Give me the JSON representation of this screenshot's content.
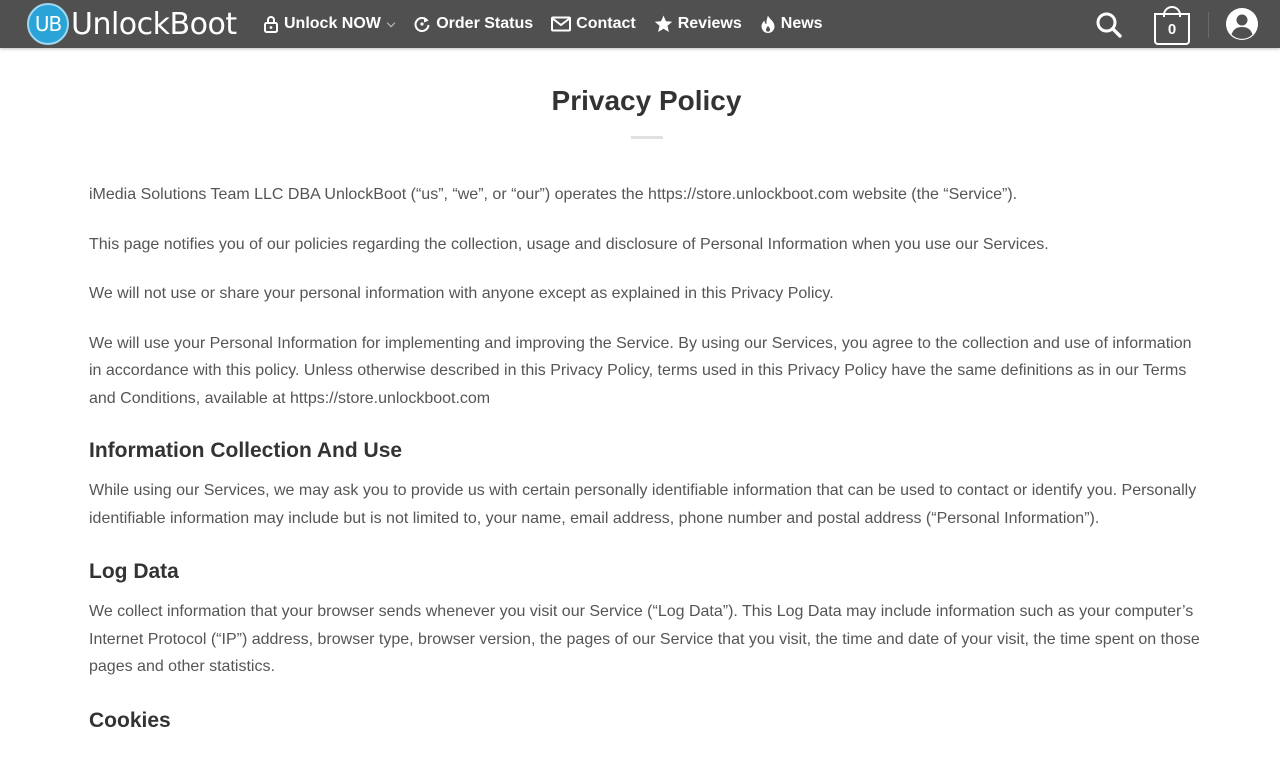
{
  "header": {
    "logo_badge": "UB",
    "logo_text": "UnlockBoot",
    "nav": [
      {
        "label": "Unlock NOW",
        "icon": "lock-icon",
        "has_dropdown": true
      },
      {
        "label": "Order Status",
        "icon": "refresh-icon"
      },
      {
        "label": "Contact",
        "icon": "envelope-icon"
      },
      {
        "label": "Reviews",
        "icon": "star-icon"
      },
      {
        "label": "News",
        "icon": "flame-icon"
      }
    ],
    "cart_count": "0",
    "colors": {
      "bar": "#505050",
      "logo_accent": "#2aa3d6"
    }
  },
  "page": {
    "title": "Privacy Policy",
    "paragraphs": [
      "iMedia Solutions Team LLC DBA UnlockBoot (“us”, “we”, or “our”) operates the https://store.unlockboot.com website (the “Service”).",
      "This page notifies you of our policies regarding the collection, usage and disclosure of Personal Information when you use our Services.",
      "We will not use or share your personal information with anyone except as explained in this Privacy Policy.",
      "We will use your Personal Information for implementing and improving the Service. By using our Services, you agree to the collection and use of information in accordance with this policy. Unless otherwise described in this Privacy Policy, terms used in this Privacy Policy have the same definitions as in our Terms and Conditions, available at https://store.unlockboot.com"
    ],
    "sections": [
      {
        "heading": "Information Collection And Use",
        "body": "While using our Services, we may ask you to provide us with certain personally identifiable information that can be used to contact or identify you. Personally identifiable information may include but is not limited to, your name, email address, phone number and postal address (“Personal Information”)."
      },
      {
        "heading": "Log Data",
        "body": "We collect information that your browser sends whenever you visit our Service (“Log Data”). This Log Data may include information such as your computer’s Internet Protocol (“IP”) address, browser type, browser version, the pages of our Service that you visit, the time and date of your visit, the time spent on those pages and other statistics."
      },
      {
        "heading": "Cookies"
      }
    ]
  }
}
